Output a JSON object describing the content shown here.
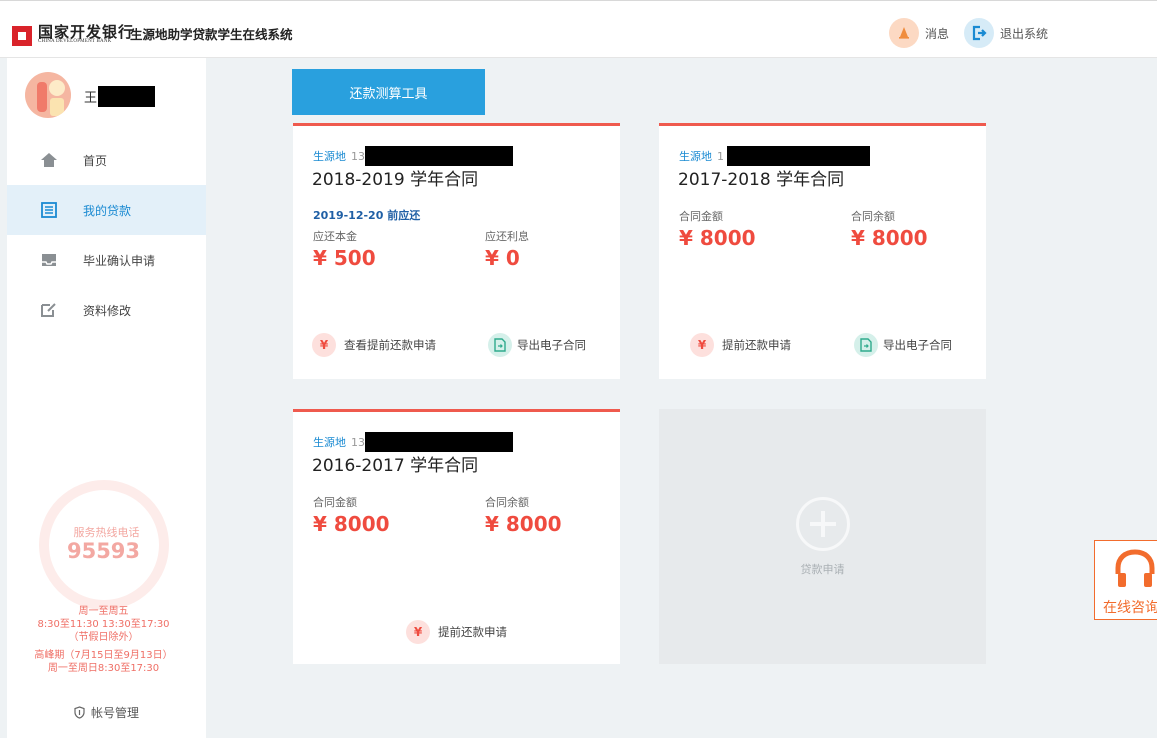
{
  "header": {
    "bank_name_cn": "国家开发银行",
    "bank_name_en": "CHINA DEVELOPMENT BANK",
    "system_title": "生源地助学贷款学生在线系统",
    "messages_label": "消息",
    "logout_label": "退出系统",
    "colors": {
      "messages_icon": "#f08c3c",
      "logout_icon": "#1a8ad2"
    }
  },
  "sidebar": {
    "user_name_prefix": "王",
    "items": [
      {
        "label": "首页",
        "icon": "home-icon",
        "active": false
      },
      {
        "label": "我的贷款",
        "icon": "list-icon",
        "active": true
      },
      {
        "label": "毕业确认申请",
        "icon": "inbox-icon",
        "active": false
      },
      {
        "label": "资料修改",
        "icon": "edit-icon",
        "active": false
      }
    ],
    "hotline_label": "服务热线电话",
    "hotline_number": "95593",
    "hours": [
      "周一至周五",
      "8:30至11:30 13:30至17:30",
      "（节假日除外）",
      "高峰期（7月15日至9月13日）",
      "周一至周日8:30至17:30"
    ],
    "account_label": "帐号管理"
  },
  "main": {
    "calc_button": "还款测算工具",
    "contracts": [
      {
        "source_label": "生源地",
        "id_prefix": "13",
        "title": "2018-2019 学年合同",
        "due_text": "2019-12-20 前应还",
        "field1_label": "应还本金",
        "field1_value": "¥ 500",
        "field2_label": "应还利息",
        "field2_value": "¥ 0",
        "action1": "查看提前还款申请",
        "action2": "导出电子合同"
      },
      {
        "source_label": "生源地",
        "id_prefix": "1",
        "title": "2017-2018 学年合同",
        "field1_label": "合同金额",
        "field1_value": "¥ 8000",
        "field2_label": "合同余额",
        "field2_value": "¥ 8000",
        "action1": "提前还款申请",
        "action2": "导出电子合同"
      },
      {
        "source_label": "生源地",
        "id_prefix": "13",
        "title": "2016-2017 学年合同",
        "field1_label": "合同金额",
        "field1_value": "¥ 8000",
        "field2_label": "合同余额",
        "field2_value": "¥ 8000",
        "action1": "提前还款申请"
      }
    ],
    "add_loan_label": "贷款申请"
  },
  "floating": {
    "consult_label": "在线咨询"
  },
  "colors": {
    "accent_blue": "#29a0de",
    "accent_red": "#ef4b3f",
    "card_top_border": "#ef5a4e",
    "consult_orange": "#f26c2d"
  }
}
